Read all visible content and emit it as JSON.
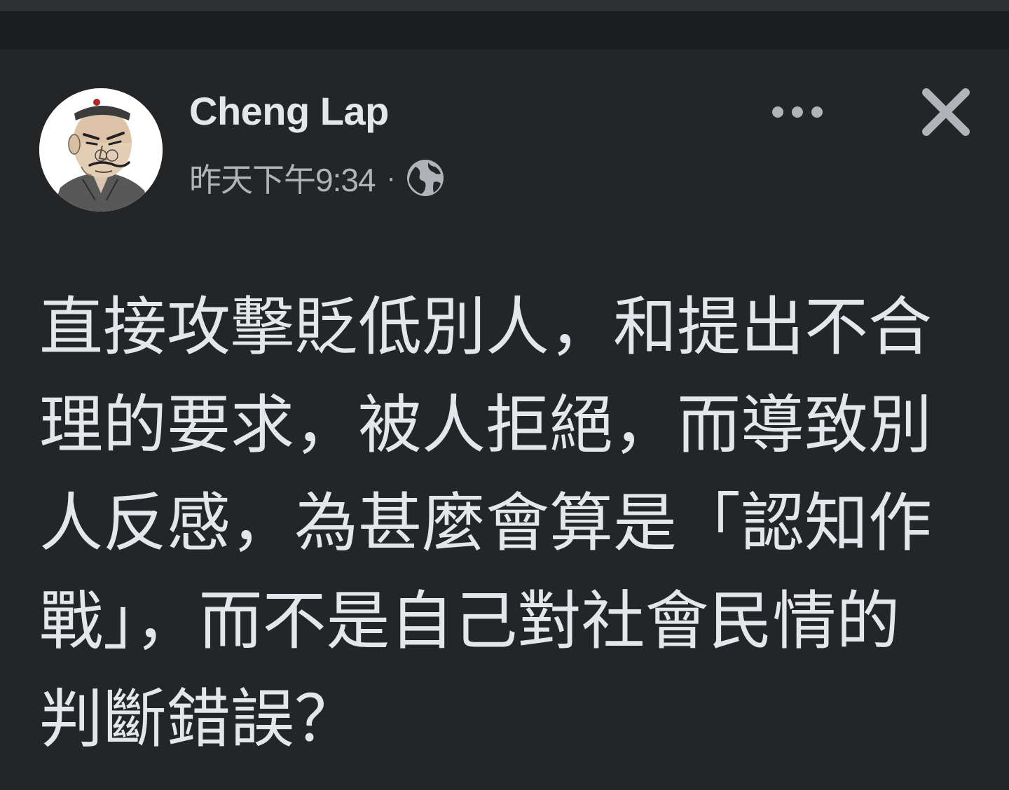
{
  "post": {
    "author": "Cheng Lap",
    "timestamp": "昨天下午9:34",
    "separator": "·",
    "audience_icon": "globe-icon",
    "text": "直接攻擊貶低別人，和提出不合理的要求，被人拒絕，而導致別人反感，為甚麼會算是「認知作戰」，而不是自己對社會民情的判斷錯誤？"
  },
  "controls": {
    "more_icon": "more-options-icon",
    "close_icon": "close-icon"
  },
  "colors": {
    "background": "#242526",
    "top_bar": "#1c1d1f",
    "primary_text": "#e4e6eb",
    "secondary_text": "#b0b3b8"
  }
}
